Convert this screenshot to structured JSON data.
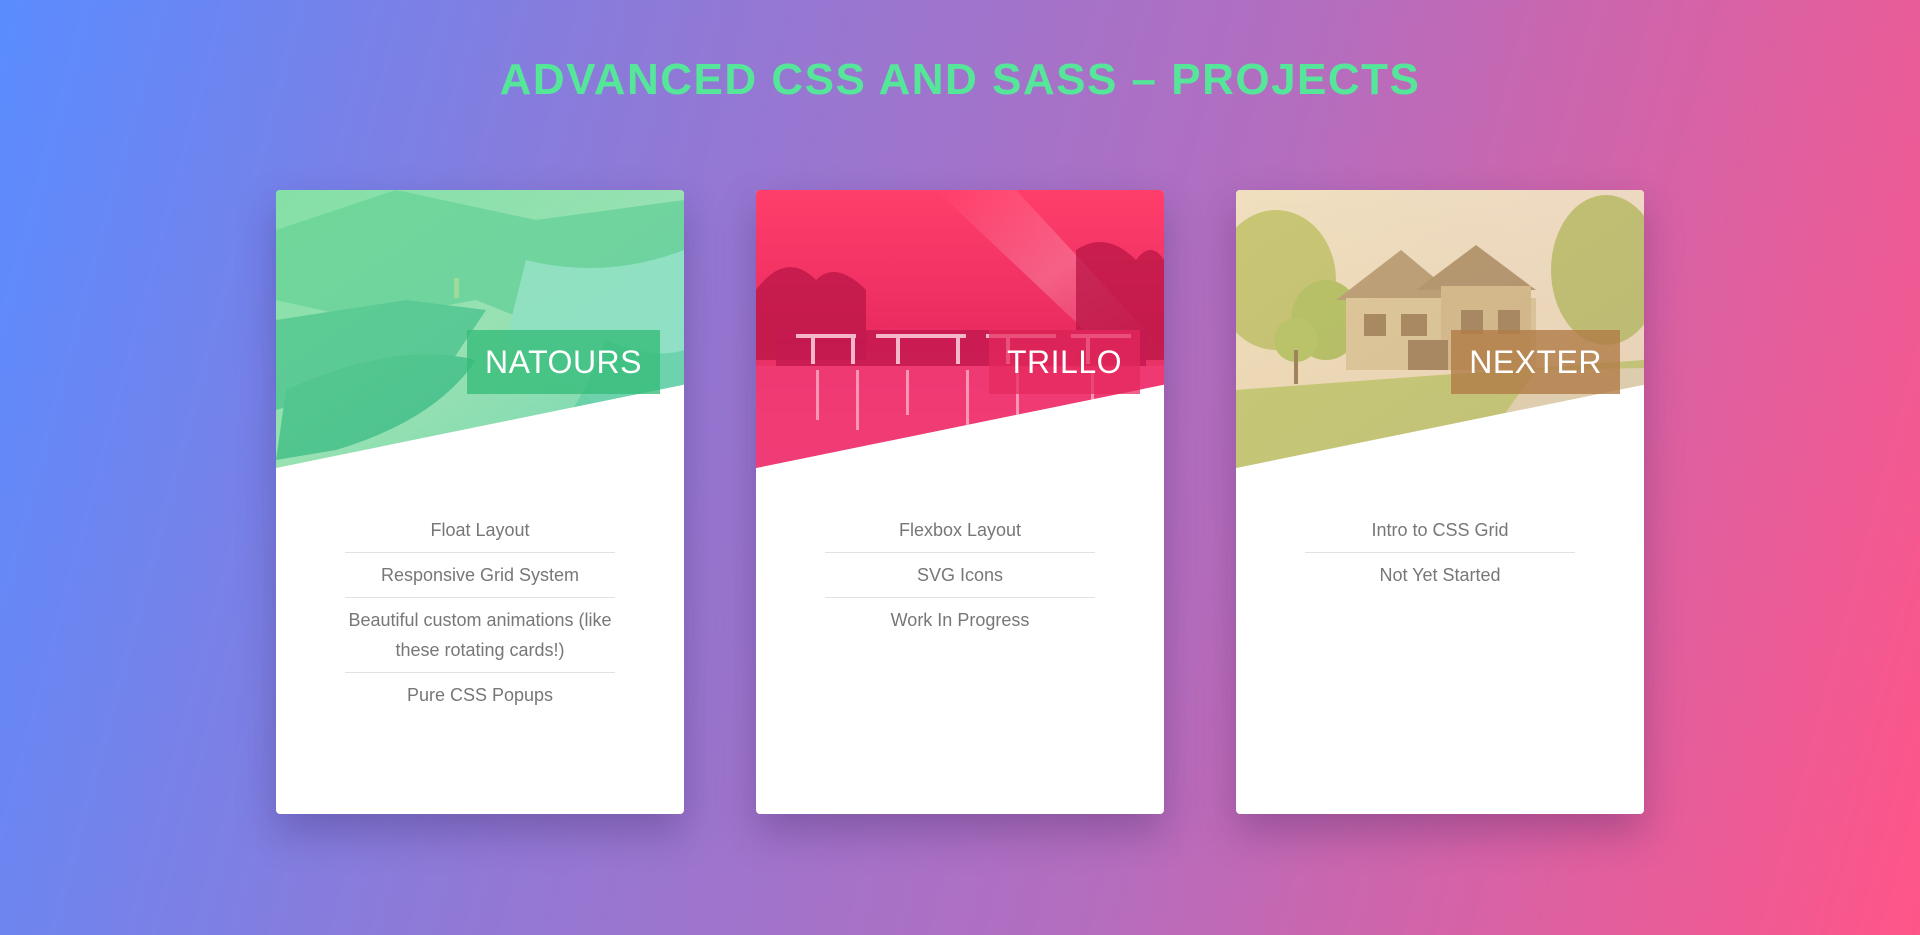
{
  "page": {
    "title": "ADVANCED CSS AND SASS – PROJECTS",
    "title_color": "#55e69a",
    "background_gradient": [
      "#5a8cff",
      "#8d7ad8",
      "#b56dbe",
      "#ff5588"
    ]
  },
  "cards": [
    {
      "heading": "NATOURS",
      "image": "mountain-lake-photo",
      "tint": "#34bc78",
      "items": [
        "Float Layout",
        "Responsive Grid System",
        "Beautiful custom animations (like these rotating cards!)",
        "Pure CSS Popups"
      ]
    },
    {
      "heading": "TRILLO",
      "image": "resort-pool-photo",
      "tint": "#e4285c",
      "items": [
        "Flexbox Layout",
        "SVG Icons",
        "Work In Progress"
      ]
    },
    {
      "heading": "NEXTER",
      "image": "suburban-house-photo",
      "tint": "#b07c46",
      "items": [
        "Intro to CSS Grid",
        "Not Yet Started"
      ]
    }
  ]
}
